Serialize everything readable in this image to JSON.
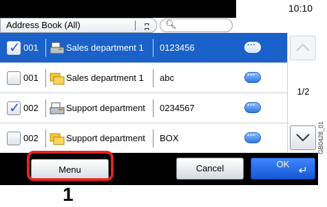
{
  "status": {
    "clock": "10:10"
  },
  "filter": {
    "address_book": "Address Book (All)"
  },
  "rows": [
    {
      "checked": true,
      "num": "001",
      "name": "Sales department 1",
      "value": "0123456",
      "type": "fax"
    },
    {
      "checked": false,
      "num": "001",
      "name": "Sales department 1",
      "value": "abc",
      "type": "folder"
    },
    {
      "checked": true,
      "num": "002",
      "name": "Support department",
      "value": "0234567",
      "type": "fax"
    },
    {
      "checked": false,
      "num": "002",
      "name": "Support department",
      "value": "BOX",
      "type": "folder"
    }
  ],
  "scroll": {
    "page": "1/2"
  },
  "bottom": {
    "menu": "Menu",
    "cancel": "Cancel",
    "ok": "OK"
  },
  "callout_number": "1",
  "figure_code": "GB0428_01",
  "colors": {
    "selected_row": "#1a61c9",
    "highlight": "#e52421",
    "ok_button": "#1557d2"
  }
}
